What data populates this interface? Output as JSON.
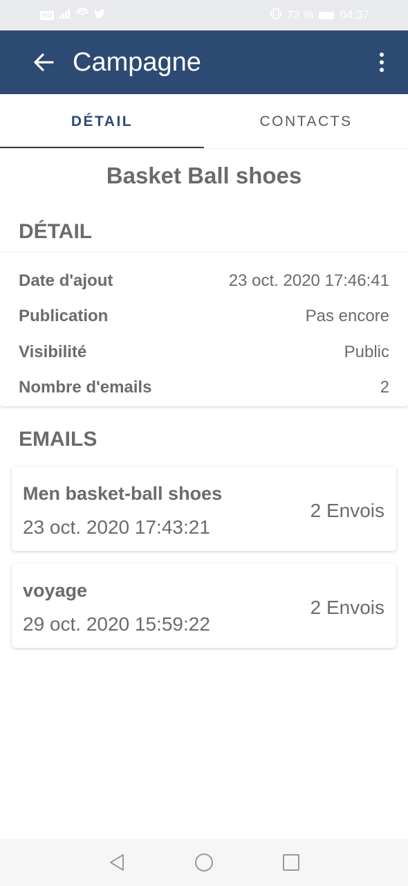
{
  "status_bar": {
    "left_chip": "HD",
    "battery": "73 %",
    "time": "04:37"
  },
  "app_bar": {
    "title": "Campagne",
    "back_icon": "arrow-left-icon",
    "menu_icon": "more-vert-icon",
    "color": "#2d4a73"
  },
  "tabs": [
    {
      "label": "DÉTAIL",
      "active": true
    },
    {
      "label": "CONTACTS",
      "active": false
    }
  ],
  "campaign": {
    "name": "Basket Ball shoes"
  },
  "detail_section": {
    "title": "DÉTAIL",
    "rows": [
      {
        "label": "Date d'ajout",
        "value": "23 oct. 2020 17:46:41"
      },
      {
        "label": "Publication",
        "value": "Pas encore"
      },
      {
        "label": "Visibilité",
        "value": "Public"
      },
      {
        "label": "Nombre d'emails",
        "value": "2"
      }
    ]
  },
  "emails_section": {
    "title": "EMAILS",
    "items": [
      {
        "name": "Men basket-ball shoes",
        "date": "23 oct. 2020 17:43:21",
        "sends": "2 Envois"
      },
      {
        "name": "voyage",
        "date": "29 oct. 2020 15:59:22",
        "sends": "2 Envois"
      }
    ]
  },
  "nav_bar": {
    "back_icon": "triangle-back-icon",
    "home_icon": "circle-home-icon",
    "recents_icon": "square-recents-icon"
  }
}
